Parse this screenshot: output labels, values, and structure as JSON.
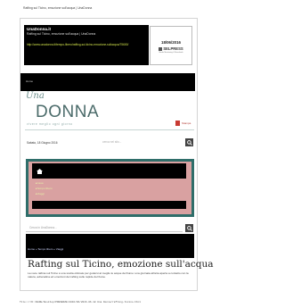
{
  "page": {
    "title": "Rafting sul Ticino, emozione sull'acqua | UnaDonna",
    "footer_url": "file:///D:/BADE/Desktop/PRESENZE/2016/06/2016.06.18 Una Donna/rafting-ticino.html"
  },
  "clipping": {
    "source": "UnaDonna.it",
    "title": "Rafting sul Ticino, emozione sull'acqua | UnaDonna",
    "url": "http://www.unadonna.it/tempo-libero/rafting-sul-ticino-emozione-sullacqua/75600/",
    "date": "18/06/2016",
    "logo_text": "SELPRESS",
    "logo_sub": "Media Monitoring & Newsbank"
  },
  "site": {
    "home_label": "Home",
    "logo_una": "Una",
    "logo_donna": "DONNA",
    "tagline": "vivere  meglio  ogni  giorno",
    "pdf_label": "Stampa",
    "date": "Sabato, 18 Giugno 2016",
    "search_placeholder": "cerca nel sito..."
  },
  "nav": {
    "items": [
      "Casa",
      "Tempo libero",
      "Viaggi"
    ]
  },
  "search2": {
    "placeholder": "Cerca in UnaDonna..."
  },
  "article": {
    "breadcrumb": "Home » Tempo libero » Viaggi",
    "title": "Rafting sul Ticino, emozione sull'acqua",
    "excerpt": "La voce raftina sul Ticino è una scelta ottimale per godersi al meglio le acque del fiume: una giornata all'aria aperta a contatto con la natura, adrenalina ed emozioni del rafting sulle rapide del fiume."
  },
  "colors": {
    "teal": "#2f6e6a",
    "pink": "#d9a1a1",
    "accent_yellow": "#cfe04a"
  }
}
